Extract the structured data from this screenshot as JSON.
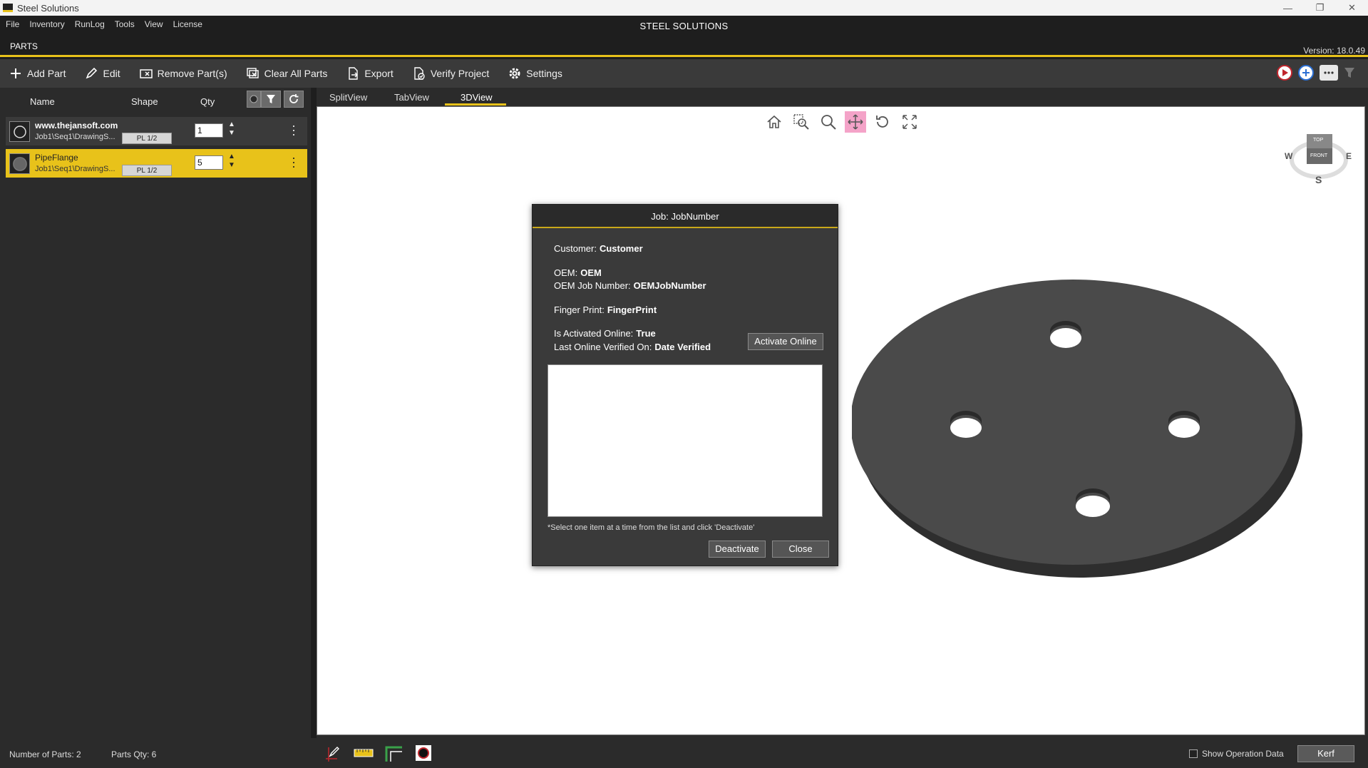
{
  "window": {
    "title": "Steel Solutions",
    "minimize": "—",
    "restore": "❐",
    "close": "✕"
  },
  "menu": {
    "items": [
      "File",
      "Inventory",
      "RunLog",
      "Tools",
      "View",
      "License"
    ],
    "app_title": "STEEL SOLUTIONS"
  },
  "tabs": {
    "parts_tab": "PARTS",
    "version": "Version: 18.0.49"
  },
  "toolbar": {
    "add_part": "Add Part",
    "edit": "Edit",
    "remove_parts": "Remove Part(s)",
    "clear_all": "Clear All Parts",
    "export": "Export",
    "verify": "Verify Project",
    "settings": "Settings"
  },
  "parts_list": {
    "headers": {
      "name": "Name",
      "shape": "Shape",
      "qty": "Qty"
    },
    "rows": [
      {
        "name": "www.thejansoft.com",
        "path": "Job1\\Seq1\\DrawingS...",
        "shape": "PL 1/2",
        "qty": "1"
      },
      {
        "name": "PipeFlange",
        "path": "Job1\\Seq1\\DrawingS...",
        "shape": "PL 1/2",
        "qty": "5"
      }
    ]
  },
  "view_tabs": {
    "split": "SplitView",
    "tab": "TabView",
    "three_d": "3DView"
  },
  "compass": {
    "top": "TOP",
    "front": "FRONT",
    "west": "W",
    "east": "E",
    "south": "S"
  },
  "dialog": {
    "title": "Job: JobNumber",
    "customer_label": "Customer:",
    "customer_value": "Customer",
    "oem_label": "OEM:",
    "oem_value": "OEM",
    "oem_job_label": "OEM Job Number:",
    "oem_job_value": "OEMJobNumber",
    "fingerprint_label": "Finger Print:",
    "fingerprint_value": "FingerPrint",
    "activated_label": "Is Activated Online:",
    "activated_value": "True",
    "verified_label": "Last Online Verified On:",
    "verified_value": "Date Verified",
    "activate_button": "Activate Online",
    "hint": "*Select one item at a time from the list and click 'Deactivate'",
    "deactivate_button": "Deactivate",
    "close_button": "Close"
  },
  "status": {
    "num_parts": "Number of Parts: 2",
    "parts_qty": "Parts Qty: 6",
    "show_op": "Show Operation Data",
    "kerf": "Kerf"
  },
  "colors": {
    "accent": "#e8c21a",
    "panel": "#2b2b2b",
    "toolbar": "#3a3a3a"
  }
}
